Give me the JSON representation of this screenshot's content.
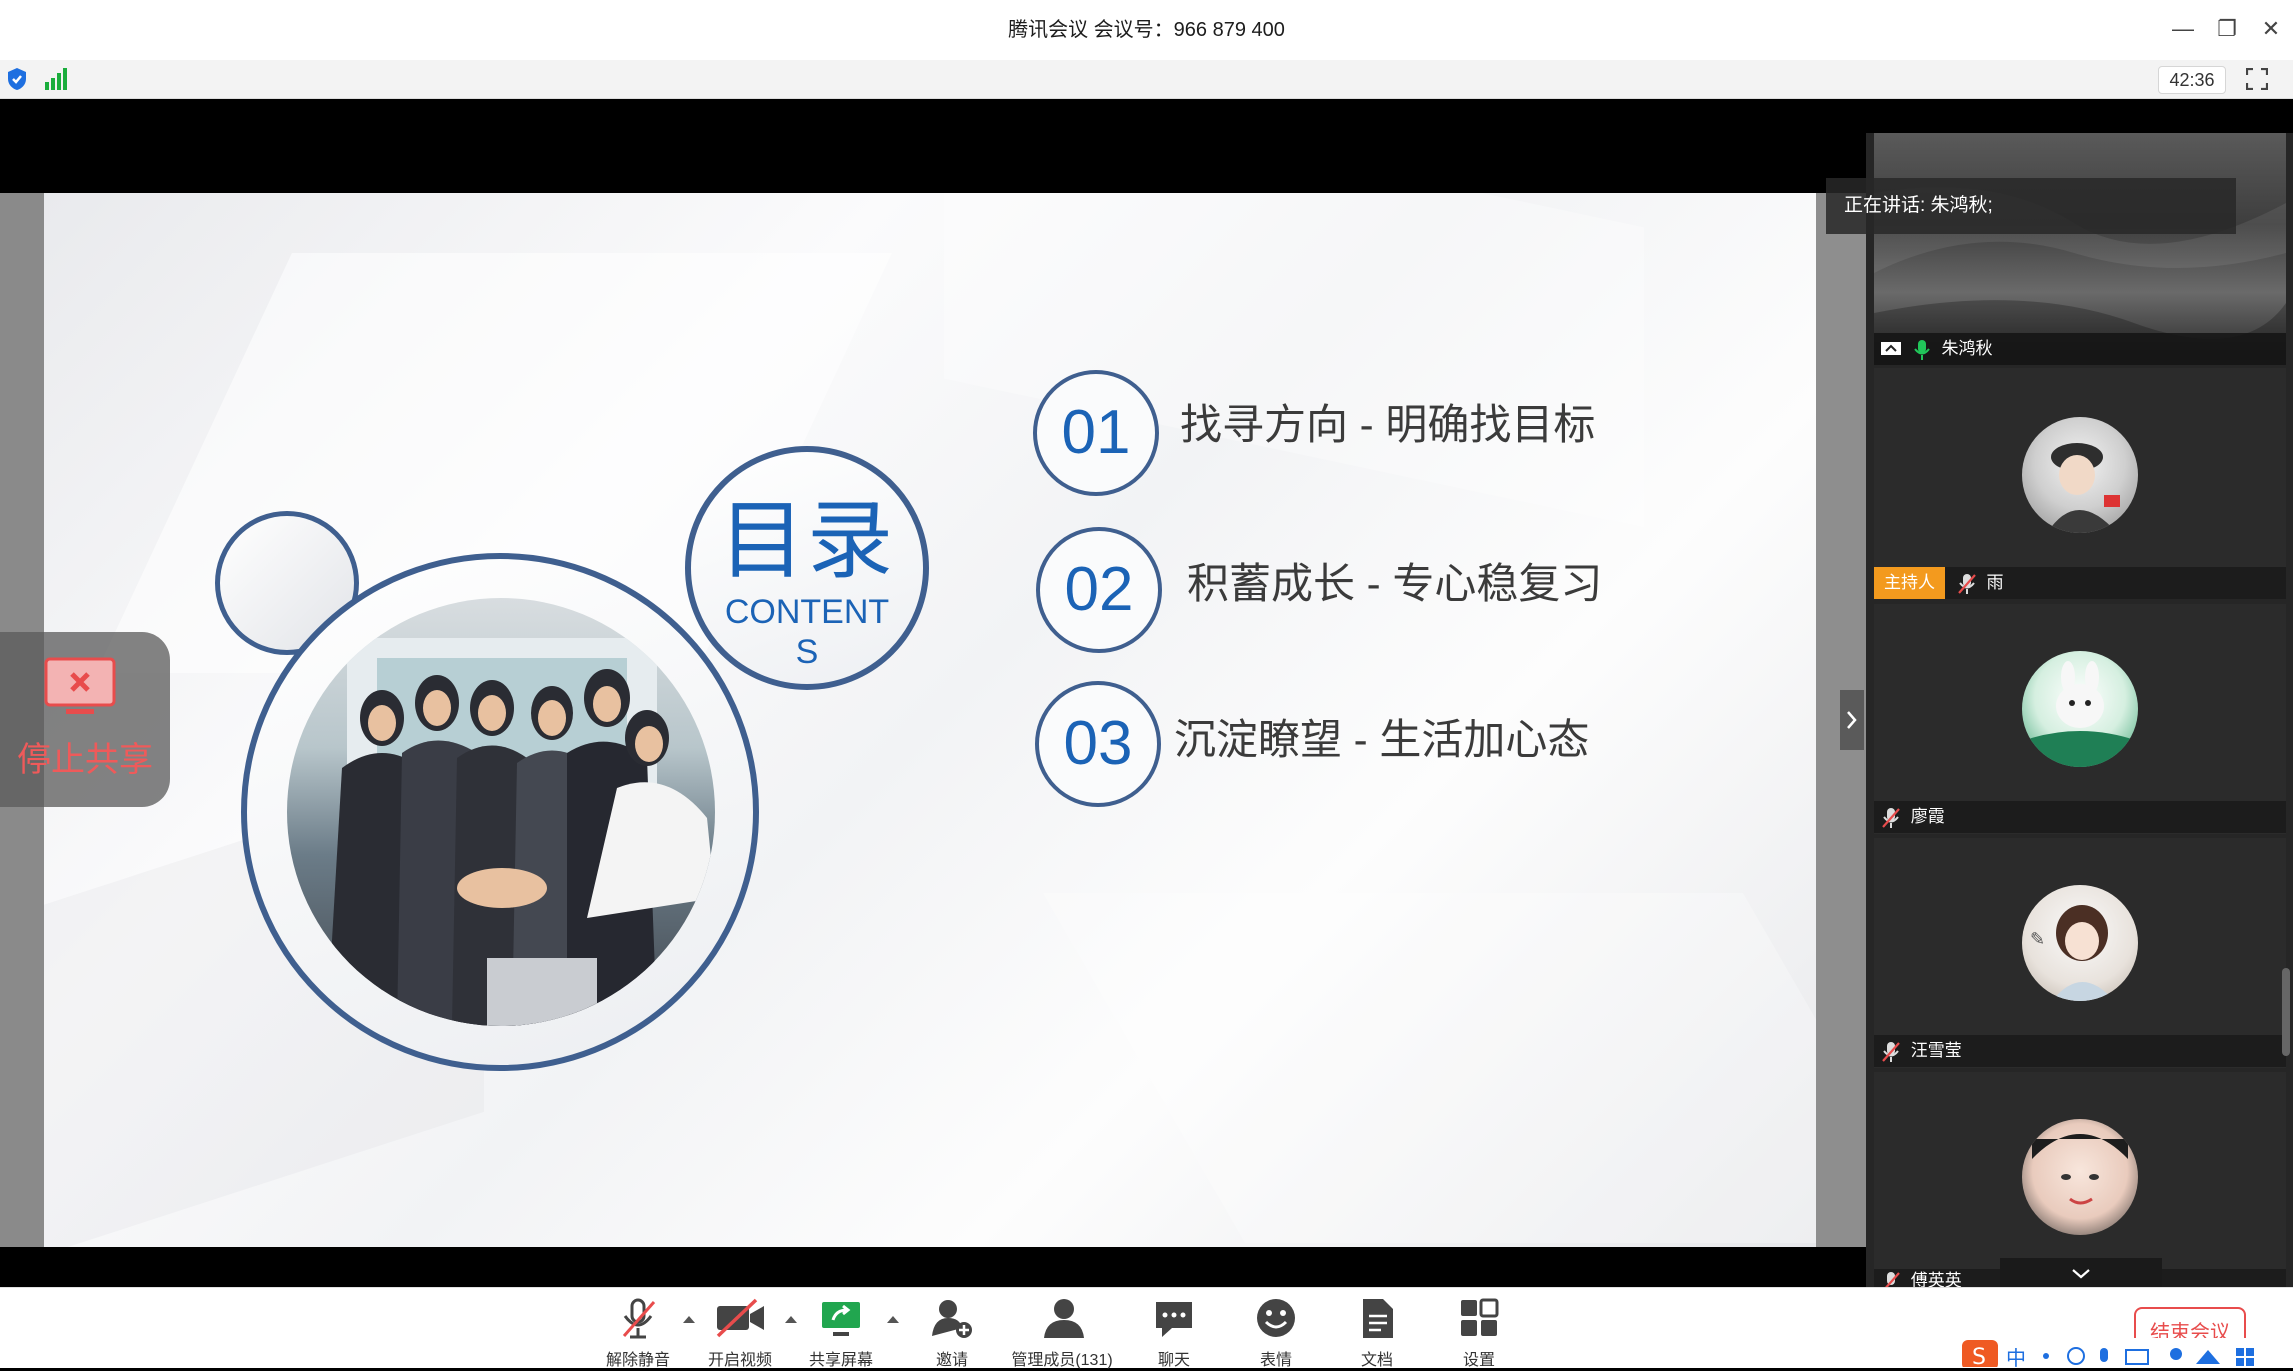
{
  "window": {
    "title": "腾讯会议 会议号：966 879 400",
    "timer": "42:36"
  },
  "slide": {
    "heading": "目录",
    "subheading_line1": "CONTENT",
    "subheading_line2": "S",
    "items": [
      {
        "num": "01",
        "text": "找寻方向 - 明确找目标"
      },
      {
        "num": "02",
        "text": "积蓄成长 - 专心稳复习"
      },
      {
        "num": "03",
        "text": "沉淀瞭望 - 生活加心态"
      }
    ]
  },
  "share_widget": {
    "label": "停止共享"
  },
  "sidebar": {
    "speaking_label": "正在讲话: 朱鸿秋;",
    "participants": [
      {
        "name": "朱鸿秋"
      },
      {
        "name": "雨",
        "badge": "主持人"
      },
      {
        "name": "廖霞"
      },
      {
        "name": "汪雪莹"
      },
      {
        "name": "傅英英"
      }
    ]
  },
  "toolbar": {
    "unmute": "解除静音",
    "start_video": "开启视频",
    "share_screen": "共享屏幕",
    "invite": "邀请",
    "manage_members": "管理成员(131)",
    "chat": "聊天",
    "reactions": "表情",
    "docs": "文档",
    "settings": "设置",
    "end_meeting": "结束会议"
  },
  "ime": {
    "lang": "中"
  },
  "colors": {
    "accent_blue": "#1b63b6",
    "ring_blue": "#3f5f8f",
    "end_red": "#e84c4c",
    "host_badge": "#f39a1e",
    "signal_green": "#1aad3c"
  }
}
